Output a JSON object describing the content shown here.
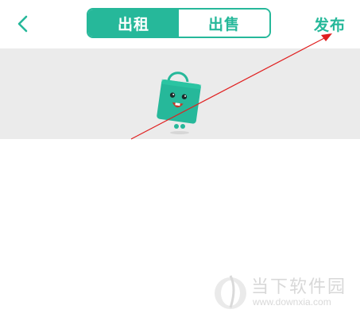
{
  "navbar": {
    "back_icon": "chevron-left-icon",
    "tabs": [
      {
        "label": "出租",
        "active": true
      },
      {
        "label": "出售",
        "active": false
      }
    ],
    "publish_label": "发布"
  },
  "banner": {
    "illustration": "shopping-bag-mascot"
  },
  "annotation": {
    "type": "arrow",
    "color": "#e02020",
    "points_to": "publish-button"
  },
  "watermark": {
    "title": "当下软件园",
    "url": "www.downxia.com"
  },
  "colors": {
    "accent": "#26b89a",
    "banner_bg": "#ebebeb",
    "arrow": "#e02020"
  }
}
